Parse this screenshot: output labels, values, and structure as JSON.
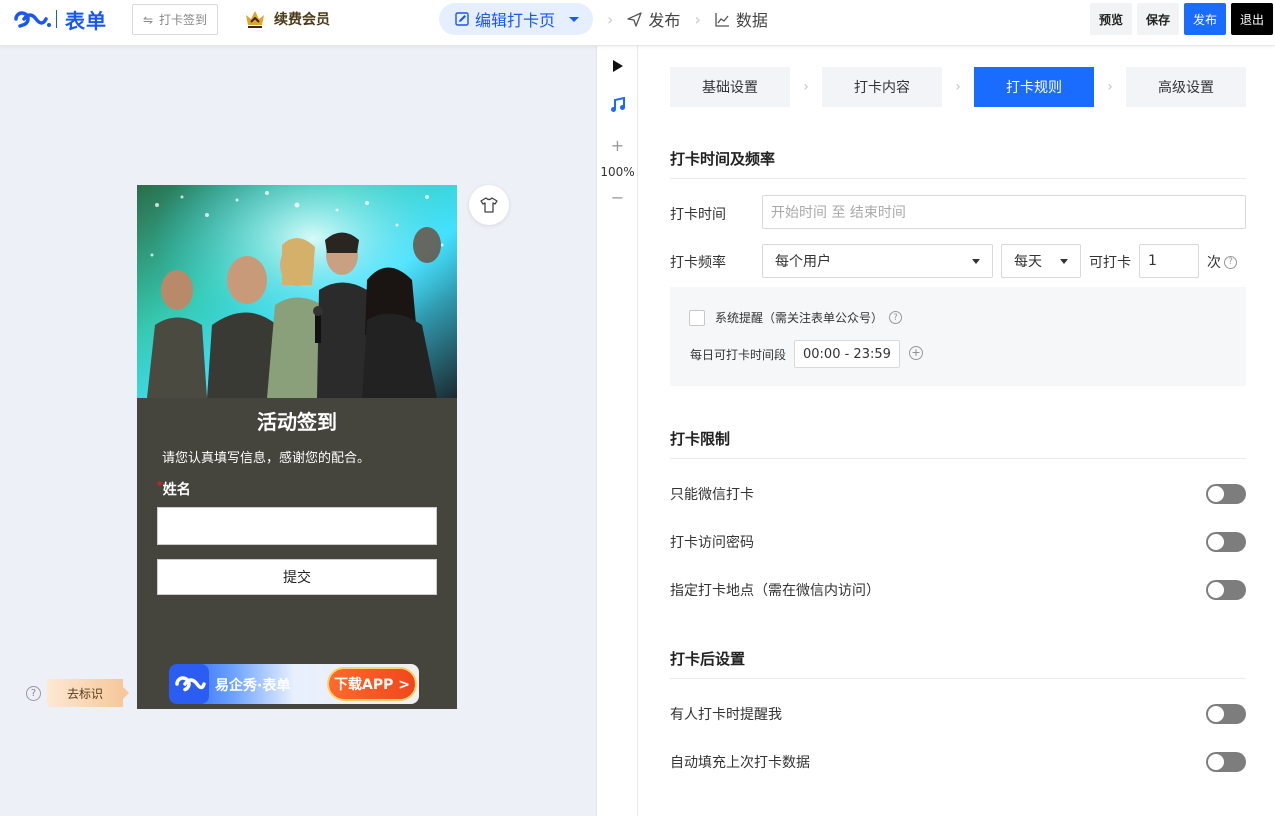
{
  "header": {
    "logo_text": "表单",
    "switch_label": "打卡签到",
    "vip_label": "续费会员",
    "nav": {
      "active": "编辑打卡页",
      "publish": "发布",
      "data": "数据"
    },
    "buttons": {
      "preview": "预览",
      "save": "保存",
      "publish": "发布",
      "exit": "退出"
    }
  },
  "preview": {
    "form_title": "活动签到",
    "form_desc": "请您认真填写信息，感谢您的配合。",
    "field_label": "姓名",
    "required_mark": "*",
    "submit_label": "提交",
    "ad_text": "易企秀·表单",
    "ad_button": "下载APP >",
    "mark_tag": "去标识",
    "help_mark": "?"
  },
  "tools": {
    "zoom": "100%",
    "zoom_in": "+",
    "zoom_out": "−"
  },
  "steps": [
    "基础设置",
    "打卡内容",
    "打卡规则",
    "高级设置"
  ],
  "active_step": 2,
  "sections": {
    "time": {
      "title": "打卡时间及频率",
      "time_label": "打卡时间",
      "time_placeholder": "开始时间 至 结束时间",
      "freq_label": "打卡频率",
      "freq_user": "每个用户",
      "freq_period": "每天",
      "can_label": "可打卡",
      "count_value": "1",
      "count_unit": "次",
      "reminder_label": "系统提醒（需关注表单公众号）",
      "daily_label": "每日可打卡时间段",
      "daily_value": "00:00 - 23:59"
    },
    "limits": {
      "title": "打卡限制",
      "items": [
        {
          "label": "只能微信打卡",
          "on": false
        },
        {
          "label": "打卡访问密码",
          "on": false
        },
        {
          "label": "指定打卡地点（需在微信内访问）",
          "on": false
        }
      ]
    },
    "after": {
      "title": "打卡后设置",
      "items": [
        {
          "label": "有人打卡时提醒我",
          "on": false
        },
        {
          "label": "自动填充上次打卡数据",
          "on": false
        }
      ]
    }
  },
  "colors": {
    "brand": "#1a56f0",
    "primary": "#1a6cff",
    "form_bg": "#45443d",
    "canvas_bg": "#eef0f8"
  }
}
